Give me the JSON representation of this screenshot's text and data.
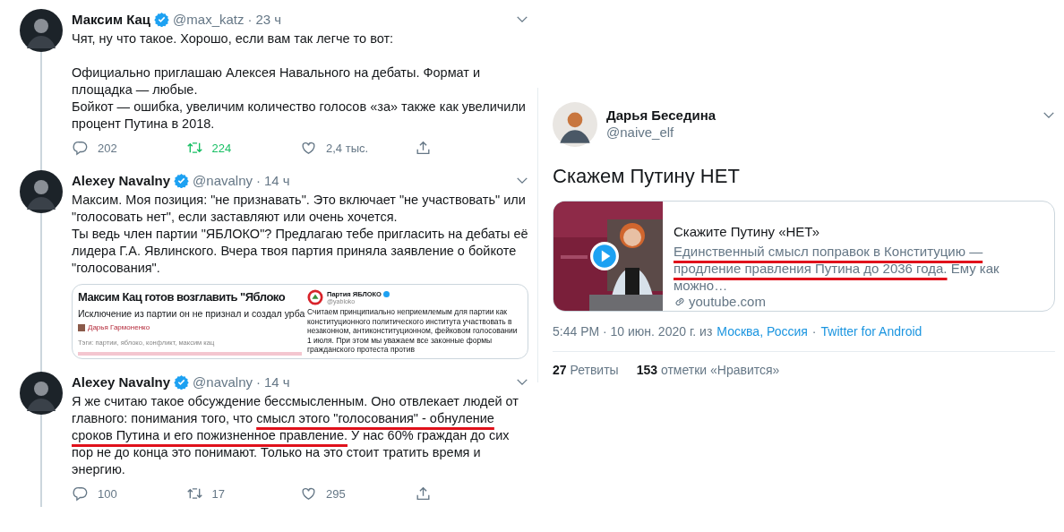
{
  "tweets": [
    {
      "name": "Максим Кац",
      "verified": true,
      "handle": "@max_katz",
      "separator": "·",
      "time": "23 ч",
      "body": [
        {
          "text": "Чят, ну что такое. Хорошо, если вам так легче то вот:\n\nОфициально приглашаю Алексея Навального на дебаты. Формат и площадка — любые.\nБойкот — ошибка, увеличим количество голосов «за» также как увеличили процент Путина в 2018.",
          "underlined": false
        }
      ],
      "actions": {
        "replies": "202",
        "retweets": "224",
        "retweeted": true,
        "likes": "2,4 тыс."
      }
    },
    {
      "name": "Alexey Navalny",
      "verified": true,
      "handle": "@navalny",
      "separator": "·",
      "time": "14 ч",
      "body": [
        {
          "text": "Максим. Моя позиция: \"не признавать\". Это включает \"не участвовать\" или \"голосовать нет\", если заставляют или очень хочется.\nТы ведь член партии \"ЯБЛОКО\"? Предлагаю тебе пригласить на дебаты её лидера Г.А. Явлинского. Вчера твоя партия приняла заявление о бойкоте \"голосования\".",
          "underlined": false
        }
      ],
      "media": {
        "kind": "screenshot",
        "article": {
          "headline": "Максим Кац готов возглавить \"Яблоко",
          "subtitle": "Исключение из партии он не признал и создал урба",
          "author": "Дарья Гармоненко",
          "tags": "Тэги: партии, яблоко, конфликт, максим кац"
        },
        "embedded_tweet": {
          "name": "Партия ЯБЛОКО",
          "verified": true,
          "handle": "@yabloko",
          "text": "Считаем принципиально неприемлемым для партии как конституционного политического института участвовать в незаконном, антиконституционном, фейковом голосовании 1 июля. При этом мы уважаем все законные формы гражданского протеста против"
        }
      }
    },
    {
      "name": "Alexey Navalny",
      "verified": true,
      "handle": "@navalny",
      "separator": "·",
      "time": "14 ч",
      "body": [
        {
          "text": "Я же считаю такое обсуждение бессмысленным. Оно отвлекает людей от главного: понимания того, что ",
          "underlined": false
        },
        {
          "text": "смысл этого \"голосования\" - обнуление сроков Путина и его пожизненное правление.",
          "underlined": true
        },
        {
          "text": " У нас 60% граждан до сих пор не до конца это понимают. Только на это стоит тратить время и энергию.",
          "underlined": false
        }
      ],
      "actions": {
        "replies": "100",
        "retweets": "17",
        "retweeted": false,
        "likes": "295"
      }
    }
  ],
  "detail_tweet": {
    "name": "Дарья Беседина",
    "handle": "@naive_elf",
    "text": "Скажем Путину НЕТ",
    "link_card": {
      "title": "Скажите Путину «НЕТ»",
      "description": [
        {
          "text": "Единственный смысл поправок в Конституцию — продление правления Путина до 2036 года.",
          "underlined": true
        },
        {
          "text": " Ему как можно…",
          "underlined": false
        }
      ],
      "domain": "youtube.com"
    },
    "meta": {
      "time": "5:44 PM · 10 июн. 2020 г. из",
      "location": "Москва, Россия",
      "separator": "·",
      "source": "Twitter for Android"
    },
    "stats": [
      {
        "count": "27",
        "label": "Ретвиты"
      },
      {
        "count": "153",
        "label": "отметки «Нравится»"
      }
    ]
  }
}
